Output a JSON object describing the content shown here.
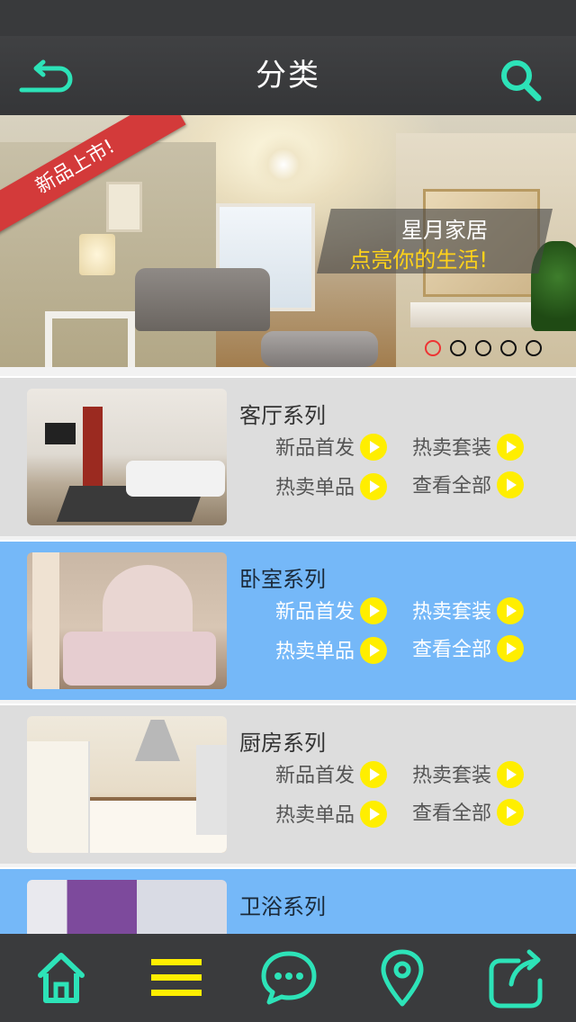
{
  "header": {
    "title": "分类",
    "back_icon": "back-arrow-icon",
    "search_icon": "search-icon",
    "accent_color": "#2de3b8"
  },
  "banner": {
    "ribbon": "新品上市!",
    "slogan_line1": "星月家居",
    "slogan_line2": "点亮你的生活!",
    "slogan_line2_color": "#ffd21a",
    "slide_count": 5,
    "active_slide": 1
  },
  "categories": [
    {
      "title": "客厅系列",
      "links": [
        "新品首发",
        "热卖套装",
        "热卖单品",
        "查看全部"
      ],
      "style": "gray"
    },
    {
      "title": "卧室系列",
      "links": [
        "新品首发",
        "热卖套装",
        "热卖单品",
        "查看全部"
      ],
      "style": "blue"
    },
    {
      "title": "厨房系列",
      "links": [
        "新品首发",
        "热卖套装",
        "热卖单品",
        "查看全部"
      ],
      "style": "gray"
    },
    {
      "title": "卫浴系列",
      "links": [],
      "style": "blue"
    }
  ],
  "tabbar": {
    "items": [
      {
        "icon": "home-icon",
        "color": "#2de3b8"
      },
      {
        "icon": "menu-icon",
        "color": "#ffee00"
      },
      {
        "icon": "chat-icon",
        "color": "#2de3b8"
      },
      {
        "icon": "location-pin-icon",
        "color": "#2de3b8"
      },
      {
        "icon": "share-icon",
        "color": "#2de3b8"
      }
    ]
  }
}
